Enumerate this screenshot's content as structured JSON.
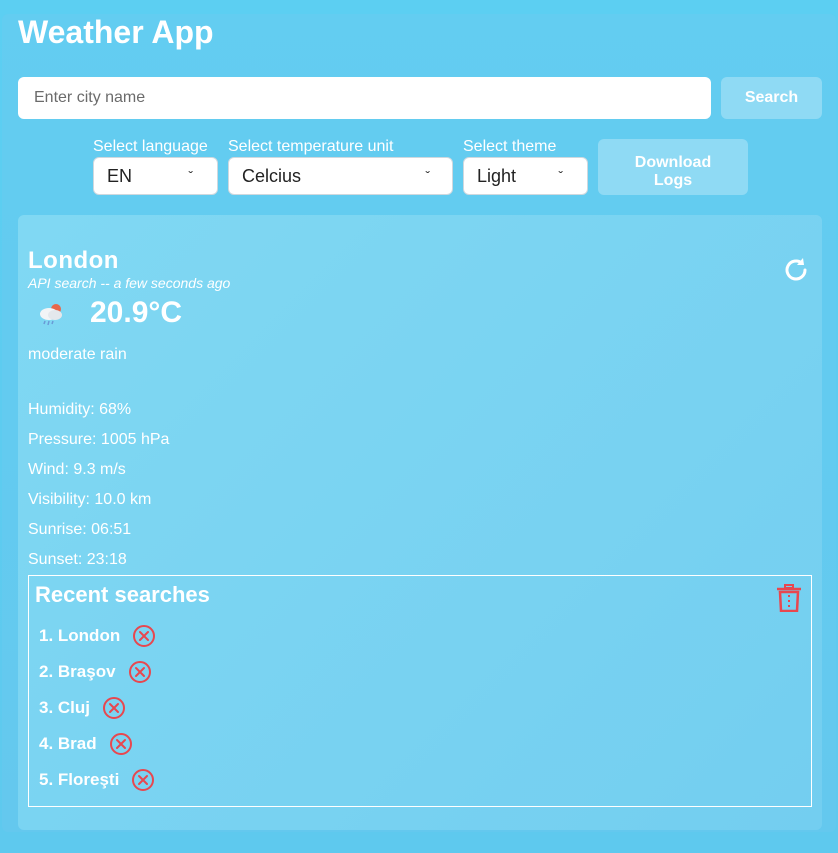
{
  "app": {
    "title": "Weather App"
  },
  "search": {
    "placeholder": "Enter city name",
    "button_label": "Search"
  },
  "controls": {
    "language_label": "Select language",
    "language_value": "EN",
    "unit_label": "Select temperature unit",
    "unit_value": "Celcius",
    "theme_label": "Select theme",
    "theme_value": "Light",
    "download_label_line1": "Download",
    "download_label_line2": "Logs"
  },
  "weather": {
    "city": "London",
    "meta": "API search -- a few seconds ago",
    "temperature": "20.9°C",
    "description": "moderate rain",
    "icon": "rain-cloud-icon",
    "details": [
      "Humidity: 68%",
      "Pressure: 1005 hPa",
      "Wind: 9.3 m/s",
      "Visibility: 10.0 km",
      "Sunrise: 06:51",
      "Sunset: 23:18"
    ]
  },
  "recent": {
    "title": "Recent searches",
    "items": [
      "1. London",
      "2. Braşov",
      "3. Cluj",
      "4. Brad",
      "5. Floreşti"
    ]
  },
  "colors": {
    "background": "#5ccff1",
    "card": "#7ad3f2",
    "button": "#8fdaf4",
    "danger": "#e8474f"
  }
}
